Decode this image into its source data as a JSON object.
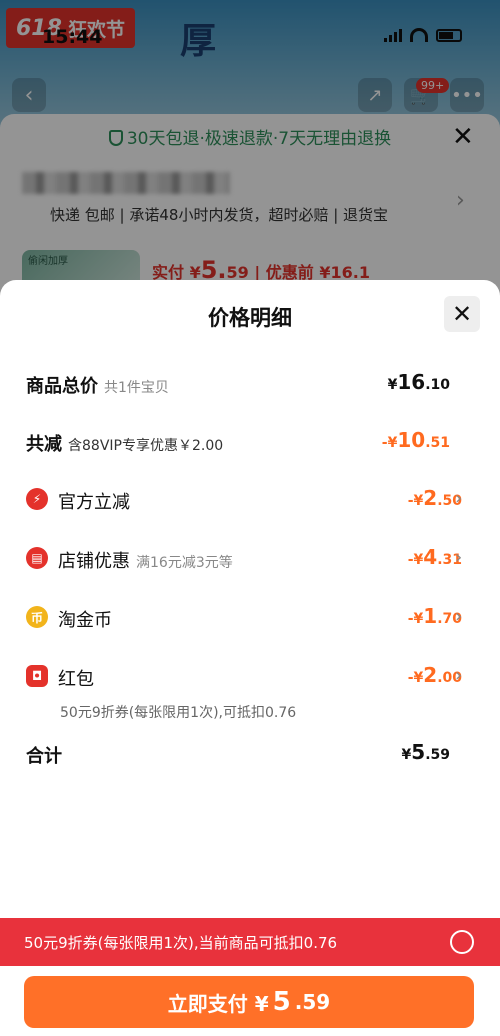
{
  "background": {
    "promo_badge": {
      "num": "618",
      "text": "狂欢节"
    },
    "promo_big_text": "厚",
    "status_time": "15:44",
    "cart_badge": "99+",
    "guarantee": "30天包退·极速退款·7天无理由退换",
    "shipping_line": "快递 包邮 | 承诺48小时内发货，超时必赔 | 退货宝",
    "product_thumb_text": "偷闲加厚",
    "price_prefix": "实付 ¥",
    "price_big": "5.",
    "price_small": "59",
    "price_before": "| 优惠前 ¥16.1",
    "icons": {
      "back": "chevron-left-icon",
      "share": "share-icon",
      "cart": "cart-icon",
      "more": "more-icon",
      "close": "close-icon"
    }
  },
  "panel": {
    "title": "价格明细",
    "close_icon": "close-icon",
    "rows": [
      {
        "label": "商品总价",
        "sub": "共1件宝贝",
        "amount_prefix": "¥",
        "amount_big": "16",
        "amount_small": ".10"
      },
      {
        "label": "共减",
        "sub": "含88VIP专享优惠￥2.00",
        "amount_prefix": "-¥",
        "amount_big": "10",
        "amount_small": ".51"
      },
      {
        "label": "官方立减",
        "sub": "",
        "amount_prefix": "-¥",
        "amount_big": "2",
        "amount_small": ".50",
        "icon": "lightning-icon"
      },
      {
        "label": "店铺优惠",
        "sub": "满16元减3元等",
        "amount_prefix": "-¥",
        "amount_big": "4",
        "amount_small": ".31",
        "icon": "shop-icon"
      },
      {
        "label": "淘金币",
        "sub": "",
        "amount_prefix": "-¥",
        "amount_big": "1",
        "amount_small": ".70",
        "icon": "coin-icon"
      },
      {
        "label": "红包",
        "sub": "",
        "amount_prefix": "-¥",
        "amount_big": "2",
        "amount_small": ".00",
        "icon": "red-packet-icon"
      },
      {
        "label": "合计",
        "sub": "",
        "amount_prefix": "¥",
        "amount_big": "5",
        "amount_small": ".59"
      }
    ],
    "redpacket_note": "50元9折券(每张限用1次),可抵扣0.76"
  },
  "coupon_bar": {
    "text": "50元9折券(每张限用1次),当前商品可抵扣0.76"
  },
  "pay_button": {
    "prefix": "立即支付 ¥",
    "big": "5",
    "small": ".59"
  },
  "colors": {
    "accent_orange": "#ff6a1f",
    "coupon_red": "#e8323c",
    "pay_orange": "#ff7028",
    "guarantee_green": "#2d8f5b"
  }
}
